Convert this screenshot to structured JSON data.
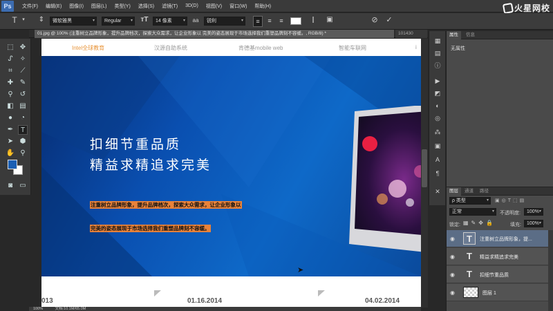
{
  "menubar": {
    "logo": "Ps",
    "items": [
      "文件(F)",
      "编辑(E)",
      "图像(I)",
      "图层(L)",
      "类型(Y)",
      "选择(S)",
      "滤镜(T)",
      "3D(D)",
      "视图(V)",
      "窗口(W)",
      "帮助(H)"
    ],
    "watermark": "火星网校"
  },
  "options": {
    "tool_icon": "text-tool-icon",
    "font_family": "微软雅黑",
    "font_style": "Regular",
    "font_size": "14 像素",
    "aa_label": "aa",
    "antialias": "锐利",
    "color_swatch": "#ffffff"
  },
  "tabs": {
    "active": "01.jpg @ 100% (注重树立品牌形象，提升品牌档次，探索大众需求，让企业形象以 完美的姿态展现于市场选择我们重塑品牌刻不容缓。, RGB/8) *",
    "other": "101430"
  },
  "canvas": {
    "nav": [
      "Intel全球教育",
      "汉源自助系统",
      "肯德基mobile web",
      "智能车联网",
      "i"
    ],
    "headline1": "扣细节重品质",
    "headline2": "精益求精追求完美",
    "hl1": "注重树立品牌形象，提升品牌档次，探索大众需求，让企业形象以",
    "hl2": "完美的姿态展现于市场选择我们重塑品牌刻不容缓。",
    "dates": [
      "013",
      "01.16.2014",
      "04.02.2014"
    ]
  },
  "status": {
    "zoom": "100%",
    "doc": "文档:10.1M/65.0M"
  },
  "colors": {
    "foreground": "#1a5fb4",
    "background": "#ffffff",
    "highlight": "#e8823a"
  },
  "properties": {
    "tabs": [
      "属性",
      "信息"
    ],
    "empty": "无属性"
  },
  "layers": {
    "tabs": [
      "图层",
      "通道",
      "路径"
    ],
    "filter": "ρ 类型",
    "blend_mode": "正常",
    "opacity_label": "不透明度:",
    "opacity": "100%",
    "lock_label": "锁定:",
    "fill_label": "填充:",
    "fill": "100%",
    "items": [
      {
        "name": "注重树立品牌形象，提...",
        "kind": "text",
        "selected": true
      },
      {
        "name": "精益求精追求完美",
        "kind": "text",
        "selected": false
      },
      {
        "name": "扣细节重品质",
        "kind": "text",
        "selected": false
      },
      {
        "name": "图层 1",
        "kind": "pixel",
        "selected": false
      }
    ]
  }
}
